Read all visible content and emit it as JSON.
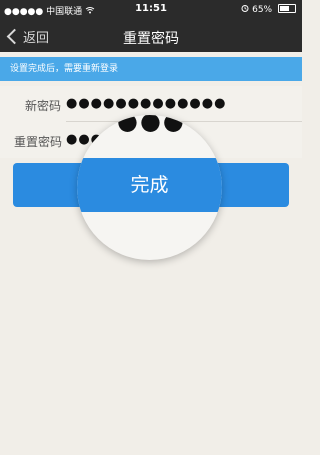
{
  "status_bar": {
    "carrier": "●●●●● 中国联通 ",
    "time": "11:51",
    "battery": "65%"
  },
  "nav": {
    "back_label": "返回",
    "title": "重置密码"
  },
  "notice": "设置完成后，需要重新登录",
  "form": {
    "new_password_label": "新密码",
    "new_password_value": "●●●●●●●●●●●●●",
    "repeat_password_label": "重置密码",
    "repeat_password_value": "●●●"
  },
  "magnifier": {
    "dots": "●●●"
  },
  "done_button": "完成"
}
